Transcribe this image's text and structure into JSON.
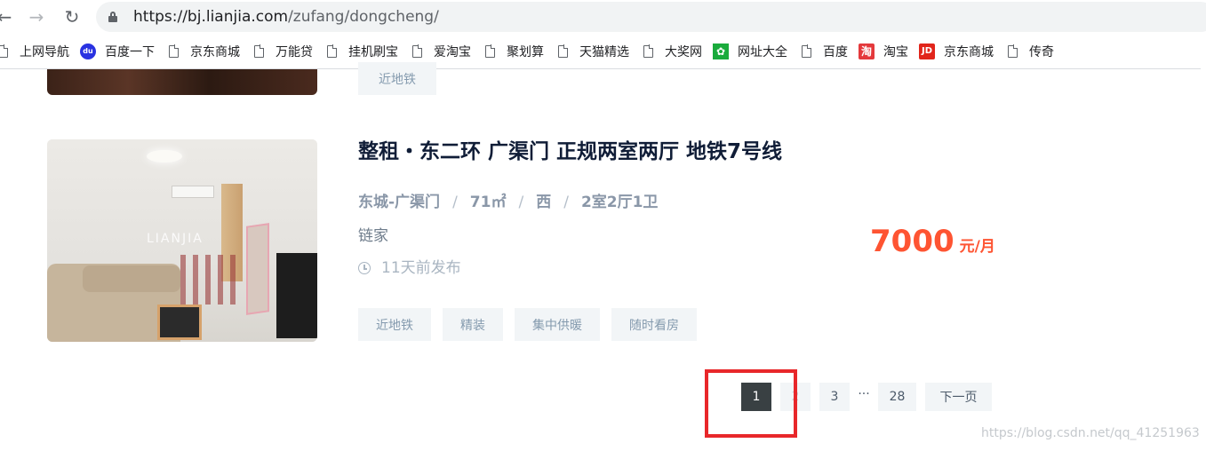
{
  "browser": {
    "url_host": "https://bj.lianjia.com",
    "url_path": "/zufang/dongcheng/",
    "bookmarks": [
      {
        "label": "上网导航",
        "icon": "document-icon"
      },
      {
        "label": "百度一下",
        "icon": "baidu-paw-icon"
      },
      {
        "label": "京东商城",
        "icon": "document-icon"
      },
      {
        "label": "万能贷",
        "icon": "document-icon"
      },
      {
        "label": "挂机刷宝",
        "icon": "document-icon"
      },
      {
        "label": "爱淘宝",
        "icon": "document-icon"
      },
      {
        "label": "聚划算",
        "icon": "document-icon"
      },
      {
        "label": "天猫精选",
        "icon": "document-icon"
      },
      {
        "label": "大奖网",
        "icon": "document-icon"
      },
      {
        "label": "网址大全",
        "icon": "hao123-icon"
      },
      {
        "label": "百度",
        "icon": "document-icon"
      },
      {
        "label": "淘宝",
        "icon": "taobao-icon"
      },
      {
        "label": "京东商城",
        "icon": "jd-icon"
      },
      {
        "label": "传奇",
        "icon": "document-icon"
      }
    ],
    "icon_glyphs": {
      "taobao": "淘",
      "jd": "JD",
      "baidu": "du",
      "hao123": "✿"
    }
  },
  "previous_listing": {
    "tag": "近地铁"
  },
  "listing": {
    "title": "整租・东二环 广渠门 正规两室两厅 地铁7号线",
    "district": "东城-广渠门",
    "area": "71㎡",
    "orientation": "西",
    "layout": "2室2厅1卫",
    "separator": "/",
    "brand": "链家",
    "published": "11天前发布",
    "price_value": "7000",
    "price_unit": "元/月",
    "photo_watermark": "LIANJIA",
    "tags": [
      "近地铁",
      "精装",
      "集中供暖",
      "随时看房"
    ]
  },
  "pagination": {
    "pages": [
      "1",
      "2",
      "3",
      "28"
    ],
    "ellipsis": "···",
    "next_label": "下一页",
    "current": "1"
  },
  "colors": {
    "price": "#fe5432",
    "title": "#101d37",
    "tag_bg": "#f2f5f7",
    "tag_text": "#849aae",
    "active_page_bg": "#394043",
    "highlight": "#e8272a"
  },
  "watermark": "https://blog.csdn.net/qq_41251963"
}
